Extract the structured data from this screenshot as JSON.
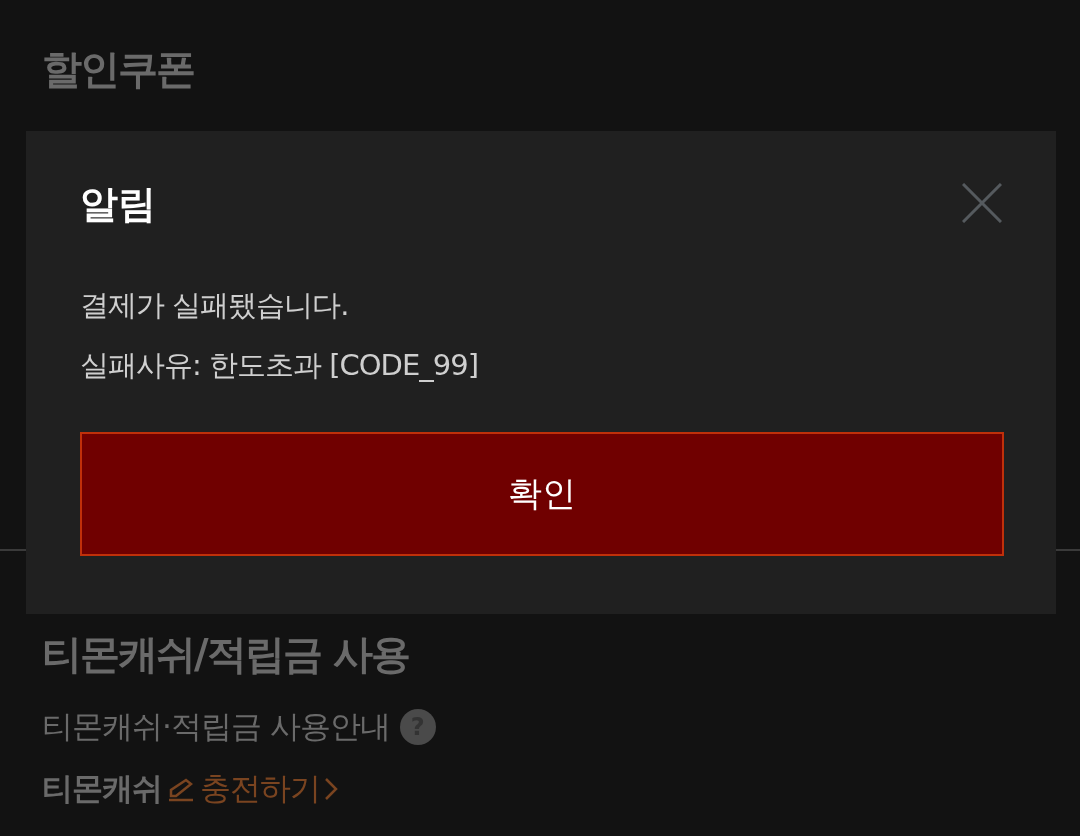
{
  "page": {
    "coupon_title": "할인쿠폰",
    "cash_title": "티몬캐쉬/적립금 사용",
    "cash_guide": "티몬캐쉬·적립금 사용안내",
    "help_icon": "?",
    "cash_label": "티몬캐쉬",
    "charge_link": "충전하기"
  },
  "dialog": {
    "title": "알림",
    "message": [
      "결제가 실패됐습니다.",
      "실패사유: 한도초과 [CODE_99]"
    ],
    "confirm": "확인"
  }
}
